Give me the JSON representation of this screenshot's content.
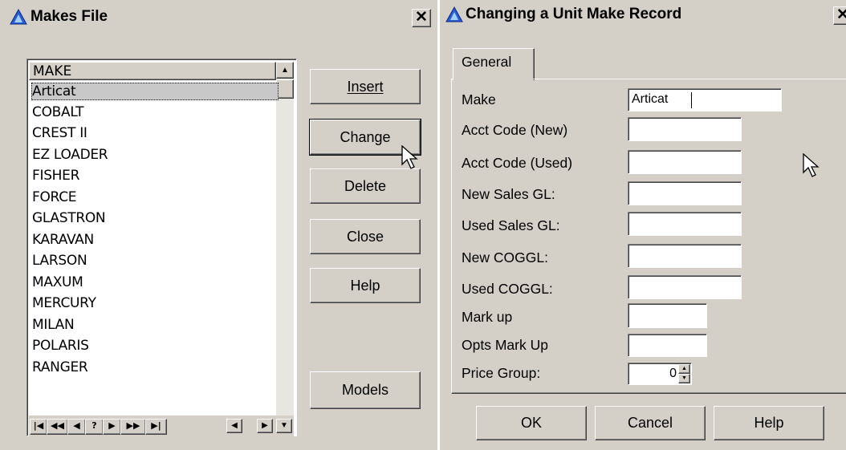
{
  "makes_window": {
    "title": "Makes File",
    "close_glyph": "✕",
    "list": {
      "header": "MAKE",
      "items": [
        "Articat",
        "COBALT",
        "CREST II",
        "EZ LOADER",
        "FISHER",
        "FORCE",
        "GLASTRON",
        "KARAVAN",
        "LARSON",
        "MAXUM",
        "MERCURY",
        "MILAN",
        "POLARIS",
        "RANGER"
      ],
      "selected": "Articat"
    },
    "buttons": {
      "insert": "Insert",
      "change": "Change",
      "delete": "Delete",
      "close": "Close",
      "help": "Help",
      "models": "Models"
    },
    "nav_glyphs": [
      "|◀",
      "◀◀",
      "◀",
      "?",
      "▶",
      "▶▶",
      "▶|"
    ]
  },
  "record_window": {
    "title": "Changing a Unit Make Record",
    "tab": "General",
    "fields": [
      {
        "label": "Make",
        "value": "Articat"
      },
      {
        "label": "Acct Code (New)",
        "value": ""
      },
      {
        "label": "Acct Code (Used)",
        "value": ""
      },
      {
        "label": "New Sales GL:",
        "value": ""
      },
      {
        "label": "Used Sales GL:",
        "value": ""
      },
      {
        "label": "New COGGL:",
        "value": ""
      },
      {
        "label": "Used COGGL:",
        "value": ""
      },
      {
        "label": "Mark up",
        "value": ""
      },
      {
        "label": "Opts Mark Up",
        "value": ""
      },
      {
        "label": "Price Group:",
        "value": "0"
      }
    ],
    "buttons": {
      "ok": "OK",
      "cancel": "Cancel",
      "help": "Help"
    }
  },
  "colors": {
    "face": "#d4d0c8",
    "icon_blue": "#2a5cd6",
    "selection": "#c8c8c8"
  }
}
